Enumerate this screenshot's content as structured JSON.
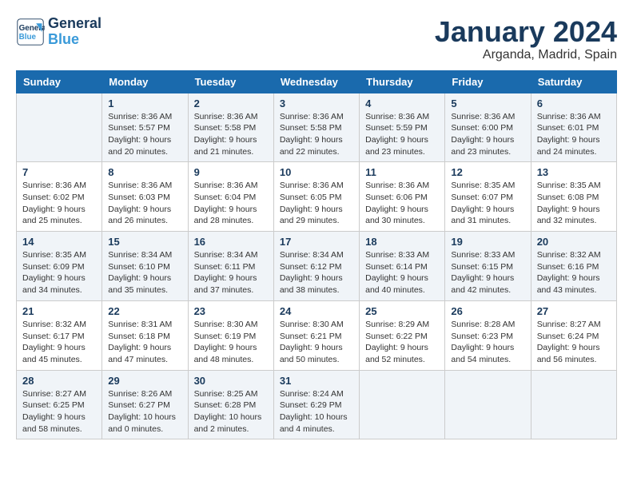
{
  "header": {
    "logo_line1": "General",
    "logo_line2": "Blue",
    "month": "January 2024",
    "location": "Arganda, Madrid, Spain"
  },
  "weekdays": [
    "Sunday",
    "Monday",
    "Tuesday",
    "Wednesday",
    "Thursday",
    "Friday",
    "Saturday"
  ],
  "weeks": [
    [
      {
        "day": "",
        "info": ""
      },
      {
        "day": "1",
        "info": "Sunrise: 8:36 AM\nSunset: 5:57 PM\nDaylight: 9 hours\nand 20 minutes."
      },
      {
        "day": "2",
        "info": "Sunrise: 8:36 AM\nSunset: 5:58 PM\nDaylight: 9 hours\nand 21 minutes."
      },
      {
        "day": "3",
        "info": "Sunrise: 8:36 AM\nSunset: 5:58 PM\nDaylight: 9 hours\nand 22 minutes."
      },
      {
        "day": "4",
        "info": "Sunrise: 8:36 AM\nSunset: 5:59 PM\nDaylight: 9 hours\nand 23 minutes."
      },
      {
        "day": "5",
        "info": "Sunrise: 8:36 AM\nSunset: 6:00 PM\nDaylight: 9 hours\nand 23 minutes."
      },
      {
        "day": "6",
        "info": "Sunrise: 8:36 AM\nSunset: 6:01 PM\nDaylight: 9 hours\nand 24 minutes."
      }
    ],
    [
      {
        "day": "7",
        "info": ""
      },
      {
        "day": "8",
        "info": "Sunrise: 8:36 AM\nSunset: 6:03 PM\nDaylight: 9 hours\nand 26 minutes."
      },
      {
        "day": "9",
        "info": "Sunrise: 8:36 AM\nSunset: 6:04 PM\nDaylight: 9 hours\nand 28 minutes."
      },
      {
        "day": "10",
        "info": "Sunrise: 8:36 AM\nSunset: 6:05 PM\nDaylight: 9 hours\nand 29 minutes."
      },
      {
        "day": "11",
        "info": "Sunrise: 8:36 AM\nSunset: 6:06 PM\nDaylight: 9 hours\nand 30 minutes."
      },
      {
        "day": "12",
        "info": "Sunrise: 8:35 AM\nSunset: 6:07 PM\nDaylight: 9 hours\nand 31 minutes."
      },
      {
        "day": "13",
        "info": "Sunrise: 8:35 AM\nSunset: 6:08 PM\nDaylight: 9 hours\nand 32 minutes."
      }
    ],
    [
      {
        "day": "14",
        "info": ""
      },
      {
        "day": "15",
        "info": "Sunrise: 8:34 AM\nSunset: 6:10 PM\nDaylight: 9 hours\nand 35 minutes."
      },
      {
        "day": "16",
        "info": "Sunrise: 8:34 AM\nSunset: 6:11 PM\nDaylight: 9 hours\nand 37 minutes."
      },
      {
        "day": "17",
        "info": "Sunrise: 8:34 AM\nSunset: 6:12 PM\nDaylight: 9 hours\nand 38 minutes."
      },
      {
        "day": "18",
        "info": "Sunrise: 8:33 AM\nSunset: 6:14 PM\nDaylight: 9 hours\nand 40 minutes."
      },
      {
        "day": "19",
        "info": "Sunrise: 8:33 AM\nSunset: 6:15 PM\nDaylight: 9 hours\nand 42 minutes."
      },
      {
        "day": "20",
        "info": "Sunrise: 8:32 AM\nSunset: 6:16 PM\nDaylight: 9 hours\nand 43 minutes."
      }
    ],
    [
      {
        "day": "21",
        "info": ""
      },
      {
        "day": "22",
        "info": "Sunrise: 8:31 AM\nSunset: 6:18 PM\nDaylight: 9 hours\nand 47 minutes."
      },
      {
        "day": "23",
        "info": "Sunrise: 8:30 AM\nSunset: 6:19 PM\nDaylight: 9 hours\nand 48 minutes."
      },
      {
        "day": "24",
        "info": "Sunrise: 8:30 AM\nSunset: 6:21 PM\nDaylight: 9 hours\nand 50 minutes."
      },
      {
        "day": "25",
        "info": "Sunrise: 8:29 AM\nSunset: 6:22 PM\nDaylight: 9 hours\nand 52 minutes."
      },
      {
        "day": "26",
        "info": "Sunrise: 8:28 AM\nSunset: 6:23 PM\nDaylight: 9 hours\nand 54 minutes."
      },
      {
        "day": "27",
        "info": "Sunrise: 8:27 AM\nSunset: 6:24 PM\nDaylight: 9 hours\nand 56 minutes."
      }
    ],
    [
      {
        "day": "28",
        "info": "Sunrise: 8:27 AM\nSunset: 6:25 PM\nDaylight: 9 hours\nand 58 minutes."
      },
      {
        "day": "29",
        "info": "Sunrise: 8:26 AM\nSunset: 6:27 PM\nDaylight: 10 hours\nand 0 minutes."
      },
      {
        "day": "30",
        "info": "Sunrise: 8:25 AM\nSunset: 6:28 PM\nDaylight: 10 hours\nand 2 minutes."
      },
      {
        "day": "31",
        "info": "Sunrise: 8:24 AM\nSunset: 6:29 PM\nDaylight: 10 hours\nand 4 minutes."
      },
      {
        "day": "",
        "info": ""
      },
      {
        "day": "",
        "info": ""
      },
      {
        "day": "",
        "info": ""
      }
    ]
  ],
  "week1_sunday": "Sunrise: 8:36 AM\nSunset: 6:02 PM\nDaylight: 9 hours\nand 25 minutes.",
  "week3_sunday": "Sunrise: 8:35 AM\nSunset: 6:09 PM\nDaylight: 9 hours\nand 34 minutes.",
  "week4_sunday": "Sunrise: 8:32 AM\nSunset: 6:17 PM\nDaylight: 9 hours\nand 45 minutes.",
  "week5_sunday": "Sunrise: 8:32 AM\nSunset: 6:17 PM\nDaylight: 9 hours\nand 45 minutes."
}
